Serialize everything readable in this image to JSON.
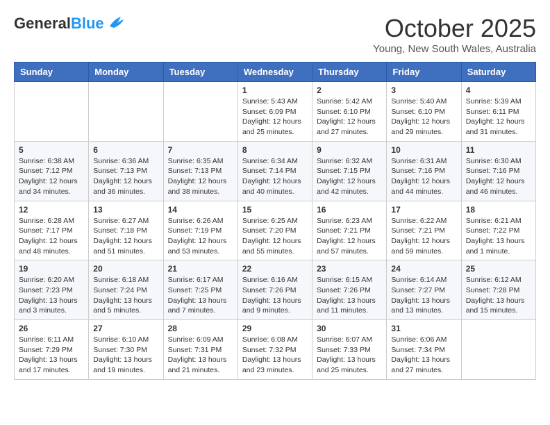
{
  "header": {
    "logo_general": "General",
    "logo_blue": "Blue",
    "month": "October 2025",
    "location": "Young, New South Wales, Australia"
  },
  "weekdays": [
    "Sunday",
    "Monday",
    "Tuesday",
    "Wednesday",
    "Thursday",
    "Friday",
    "Saturday"
  ],
  "weeks": [
    [
      {
        "day": "",
        "info": ""
      },
      {
        "day": "",
        "info": ""
      },
      {
        "day": "",
        "info": ""
      },
      {
        "day": "1",
        "info": "Sunrise: 5:43 AM\nSunset: 6:09 PM\nDaylight: 12 hours and 25 minutes."
      },
      {
        "day": "2",
        "info": "Sunrise: 5:42 AM\nSunset: 6:10 PM\nDaylight: 12 hours and 27 minutes."
      },
      {
        "day": "3",
        "info": "Sunrise: 5:40 AM\nSunset: 6:10 PM\nDaylight: 12 hours and 29 minutes."
      },
      {
        "day": "4",
        "info": "Sunrise: 5:39 AM\nSunset: 6:11 PM\nDaylight: 12 hours and 31 minutes."
      }
    ],
    [
      {
        "day": "5",
        "info": "Sunrise: 6:38 AM\nSunset: 7:12 PM\nDaylight: 12 hours and 34 minutes."
      },
      {
        "day": "6",
        "info": "Sunrise: 6:36 AM\nSunset: 7:13 PM\nDaylight: 12 hours and 36 minutes."
      },
      {
        "day": "7",
        "info": "Sunrise: 6:35 AM\nSunset: 7:13 PM\nDaylight: 12 hours and 38 minutes."
      },
      {
        "day": "8",
        "info": "Sunrise: 6:34 AM\nSunset: 7:14 PM\nDaylight: 12 hours and 40 minutes."
      },
      {
        "day": "9",
        "info": "Sunrise: 6:32 AM\nSunset: 7:15 PM\nDaylight: 12 hours and 42 minutes."
      },
      {
        "day": "10",
        "info": "Sunrise: 6:31 AM\nSunset: 7:16 PM\nDaylight: 12 hours and 44 minutes."
      },
      {
        "day": "11",
        "info": "Sunrise: 6:30 AM\nSunset: 7:16 PM\nDaylight: 12 hours and 46 minutes."
      }
    ],
    [
      {
        "day": "12",
        "info": "Sunrise: 6:28 AM\nSunset: 7:17 PM\nDaylight: 12 hours and 48 minutes."
      },
      {
        "day": "13",
        "info": "Sunrise: 6:27 AM\nSunset: 7:18 PM\nDaylight: 12 hours and 51 minutes."
      },
      {
        "day": "14",
        "info": "Sunrise: 6:26 AM\nSunset: 7:19 PM\nDaylight: 12 hours and 53 minutes."
      },
      {
        "day": "15",
        "info": "Sunrise: 6:25 AM\nSunset: 7:20 PM\nDaylight: 12 hours and 55 minutes."
      },
      {
        "day": "16",
        "info": "Sunrise: 6:23 AM\nSunset: 7:21 PM\nDaylight: 12 hours and 57 minutes."
      },
      {
        "day": "17",
        "info": "Sunrise: 6:22 AM\nSunset: 7:21 PM\nDaylight: 12 hours and 59 minutes."
      },
      {
        "day": "18",
        "info": "Sunrise: 6:21 AM\nSunset: 7:22 PM\nDaylight: 13 hours and 1 minute."
      }
    ],
    [
      {
        "day": "19",
        "info": "Sunrise: 6:20 AM\nSunset: 7:23 PM\nDaylight: 13 hours and 3 minutes."
      },
      {
        "day": "20",
        "info": "Sunrise: 6:18 AM\nSunset: 7:24 PM\nDaylight: 13 hours and 5 minutes."
      },
      {
        "day": "21",
        "info": "Sunrise: 6:17 AM\nSunset: 7:25 PM\nDaylight: 13 hours and 7 minutes."
      },
      {
        "day": "22",
        "info": "Sunrise: 6:16 AM\nSunset: 7:26 PM\nDaylight: 13 hours and 9 minutes."
      },
      {
        "day": "23",
        "info": "Sunrise: 6:15 AM\nSunset: 7:26 PM\nDaylight: 13 hours and 11 minutes."
      },
      {
        "day": "24",
        "info": "Sunrise: 6:14 AM\nSunset: 7:27 PM\nDaylight: 13 hours and 13 minutes."
      },
      {
        "day": "25",
        "info": "Sunrise: 6:12 AM\nSunset: 7:28 PM\nDaylight: 13 hours and 15 minutes."
      }
    ],
    [
      {
        "day": "26",
        "info": "Sunrise: 6:11 AM\nSunset: 7:29 PM\nDaylight: 13 hours and 17 minutes."
      },
      {
        "day": "27",
        "info": "Sunrise: 6:10 AM\nSunset: 7:30 PM\nDaylight: 13 hours and 19 minutes."
      },
      {
        "day": "28",
        "info": "Sunrise: 6:09 AM\nSunset: 7:31 PM\nDaylight: 13 hours and 21 minutes."
      },
      {
        "day": "29",
        "info": "Sunrise: 6:08 AM\nSunset: 7:32 PM\nDaylight: 13 hours and 23 minutes."
      },
      {
        "day": "30",
        "info": "Sunrise: 6:07 AM\nSunset: 7:33 PM\nDaylight: 13 hours and 25 minutes."
      },
      {
        "day": "31",
        "info": "Sunrise: 6:06 AM\nSunset: 7:34 PM\nDaylight: 13 hours and 27 minutes."
      },
      {
        "day": "",
        "info": ""
      }
    ]
  ]
}
